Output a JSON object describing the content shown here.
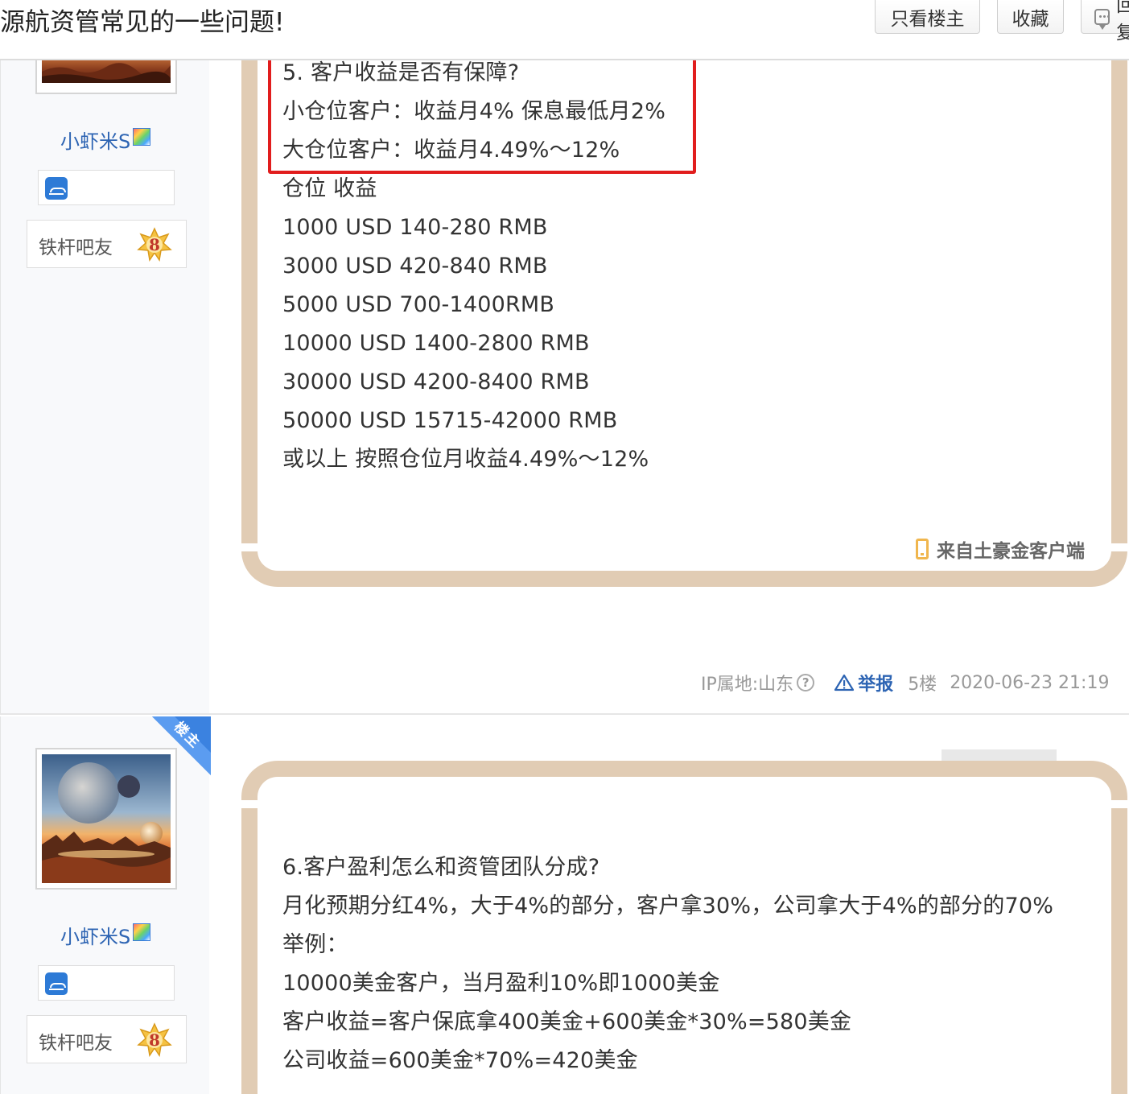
{
  "header": {
    "thread_title": "源航资管常见的一些问题!",
    "only_op_button": "只看楼主",
    "favorite_button": "收藏",
    "reply_button": "回复"
  },
  "post1": {
    "username": "小虾米S",
    "level_name": "铁杆吧友",
    "level_number": "8",
    "highlighted_lines": [
      "5. 客户收益是否有保障?",
      "小仓位客户：收益月4% 保息最低月2%",
      "大仓位客户：收益月4.49%～12%"
    ],
    "lines": [
      "仓位 收益",
      "1000 USD 140-280 RMB",
      "3000 USD 420-840 RMB",
      "5000 USD 700-1400RMB",
      "10000 USD 1400-2800 RMB",
      "30000 USD 4200-8400 RMB",
      "50000 USD 15715-42000 RMB",
      "或以上 按照仓位月收益4.49%～12%"
    ],
    "client_source": "来自土豪金客户端",
    "ip_location": "IP属地:山东",
    "help_symbol": "?",
    "report_label": "举报",
    "floor": "5楼",
    "timestamp": "2020-06-23 21:19"
  },
  "post2": {
    "op_ribbon": "楼主",
    "username": "小虾米S",
    "level_name": "铁杆吧友",
    "level_number": "8",
    "lines": [
      "6.客户盈利怎么和资管团队分成?",
      "月化预期分红4%，大于4%的部分，客户拿30%，公司拿大于4%的部分的70%",
      "举例：",
      "10000美金客户，当月盈利10%即1000美金",
      "客户收益=客户保底拿400美金+600美金*30%=580美金",
      "公司收益=600美金*70%=420美金"
    ]
  },
  "colors": {
    "frame": "#e1ccb4",
    "highlight": "#e11d1d",
    "link": "#2d64b3",
    "ribbon": "#3b82e0"
  }
}
